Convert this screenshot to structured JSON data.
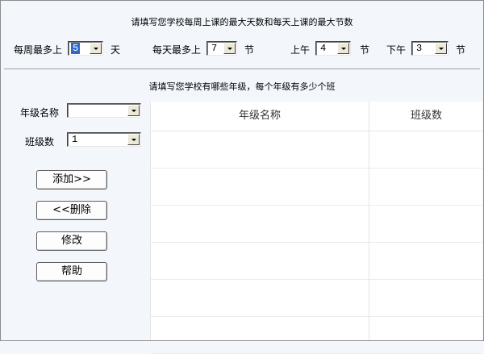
{
  "section1": {
    "title": "请填写您学校每周上课的最大天数和每天上课的最大节数",
    "week_label": "每周最多上",
    "week_value": "5",
    "week_unit": "天",
    "day_label": "每天最多上",
    "day_value": "7",
    "day_unit": "节",
    "morning_label": "上午",
    "morning_value": "4",
    "morning_unit": "节",
    "afternoon_label": "下午",
    "afternoon_value": "3",
    "afternoon_unit": "节"
  },
  "section2": {
    "title": "请填写您学校有哪些年级，每个年级有多少个班",
    "grade_name_label": "年级名称",
    "grade_name_value": "",
    "class_count_label": "班级数",
    "class_count_value": "1"
  },
  "buttons": {
    "add": "添加>>",
    "delete": "<<删除",
    "edit": "修改",
    "help": "帮助"
  },
  "table": {
    "columns": [
      "年级名称",
      "班级数"
    ],
    "rows": [
      [
        "",
        ""
      ],
      [
        "",
        ""
      ],
      [
        "",
        ""
      ],
      [
        "",
        ""
      ],
      [
        "",
        ""
      ],
      [
        "",
        ""
      ]
    ]
  },
  "colors": {
    "background": "#f3f6fb",
    "selection": "#316ac5"
  }
}
